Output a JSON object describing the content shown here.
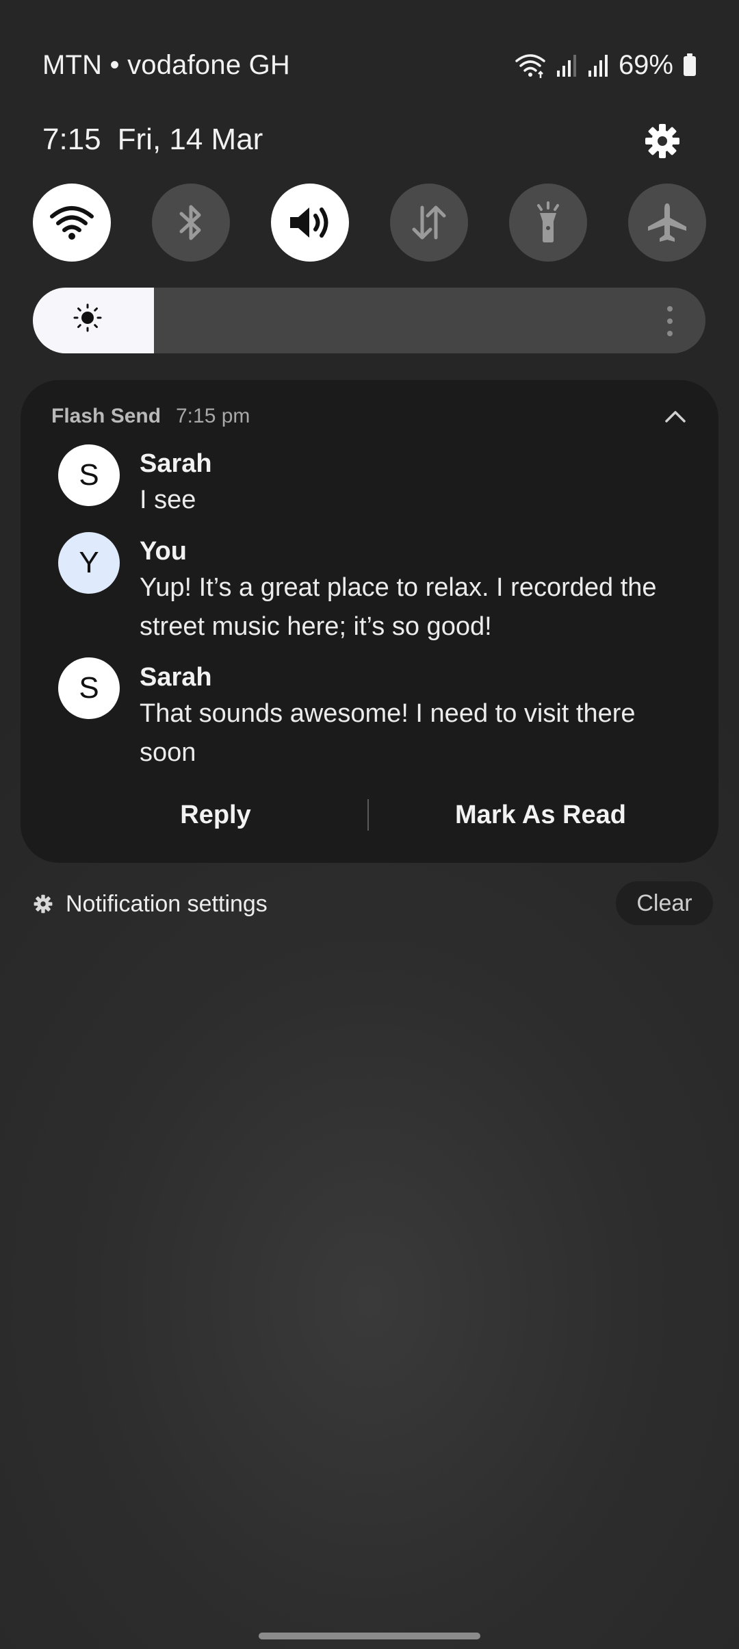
{
  "status_bar": {
    "carrier": "MTN • vodafone GH",
    "battery_percent": "69%",
    "icons": [
      "wifi-icon",
      "signal-icon",
      "signal-icon",
      "battery-icon"
    ]
  },
  "header": {
    "time": "7:15",
    "date": "Fri, 14 Mar",
    "settings_icon": "gear-icon"
  },
  "quick_settings": [
    {
      "icon": "wifi-icon",
      "state": "on"
    },
    {
      "icon": "bluetooth-icon",
      "state": "off"
    },
    {
      "icon": "sound-icon",
      "state": "on"
    },
    {
      "icon": "mobile-data-icon",
      "state": "off"
    },
    {
      "icon": "flashlight-icon",
      "state": "off"
    },
    {
      "icon": "airplane-icon",
      "state": "off"
    }
  ],
  "brightness": {
    "level": 0.18,
    "icon": "sun-icon"
  },
  "notification": {
    "app_name": "Flash Send",
    "time": "7:15 pm",
    "messages": [
      {
        "avatar": "S",
        "sender": "Sarah",
        "text": "I see"
      },
      {
        "avatar": "Y",
        "sender": "You",
        "text": "Yup! It’s a great place to relax. I recorded the street music here; it’s so good!"
      },
      {
        "avatar": "S",
        "sender": "Sarah",
        "text": "That sounds awesome! I need to visit there soon"
      }
    ],
    "actions": {
      "reply": "Reply",
      "mark_read": "Mark As Read"
    }
  },
  "footer": {
    "settings_label": "Notification settings",
    "clear_label": "Clear"
  },
  "colors": {
    "background": "#2d2d2d",
    "card": "#1b1b1b",
    "toggle_on": "#ffffff",
    "toggle_off": "#4a4a4a",
    "you_avatar": "#dfeafc"
  }
}
